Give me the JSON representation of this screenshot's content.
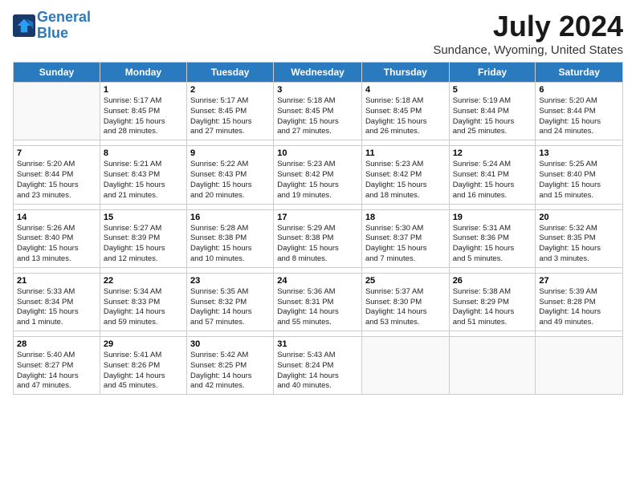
{
  "header": {
    "logo_line1": "General",
    "logo_line2": "Blue",
    "title": "July 2024",
    "subtitle": "Sundance, Wyoming, United States"
  },
  "days_of_week": [
    "Sunday",
    "Monday",
    "Tuesday",
    "Wednesday",
    "Thursday",
    "Friday",
    "Saturday"
  ],
  "weeks": [
    [
      {
        "num": "",
        "info": ""
      },
      {
        "num": "1",
        "info": "Sunrise: 5:17 AM\nSunset: 8:45 PM\nDaylight: 15 hours\nand 28 minutes."
      },
      {
        "num": "2",
        "info": "Sunrise: 5:17 AM\nSunset: 8:45 PM\nDaylight: 15 hours\nand 27 minutes."
      },
      {
        "num": "3",
        "info": "Sunrise: 5:18 AM\nSunset: 8:45 PM\nDaylight: 15 hours\nand 27 minutes."
      },
      {
        "num": "4",
        "info": "Sunrise: 5:18 AM\nSunset: 8:45 PM\nDaylight: 15 hours\nand 26 minutes."
      },
      {
        "num": "5",
        "info": "Sunrise: 5:19 AM\nSunset: 8:44 PM\nDaylight: 15 hours\nand 25 minutes."
      },
      {
        "num": "6",
        "info": "Sunrise: 5:20 AM\nSunset: 8:44 PM\nDaylight: 15 hours\nand 24 minutes."
      }
    ],
    [
      {
        "num": "7",
        "info": "Sunrise: 5:20 AM\nSunset: 8:44 PM\nDaylight: 15 hours\nand 23 minutes."
      },
      {
        "num": "8",
        "info": "Sunrise: 5:21 AM\nSunset: 8:43 PM\nDaylight: 15 hours\nand 21 minutes."
      },
      {
        "num": "9",
        "info": "Sunrise: 5:22 AM\nSunset: 8:43 PM\nDaylight: 15 hours\nand 20 minutes."
      },
      {
        "num": "10",
        "info": "Sunrise: 5:23 AM\nSunset: 8:42 PM\nDaylight: 15 hours\nand 19 minutes."
      },
      {
        "num": "11",
        "info": "Sunrise: 5:23 AM\nSunset: 8:42 PM\nDaylight: 15 hours\nand 18 minutes."
      },
      {
        "num": "12",
        "info": "Sunrise: 5:24 AM\nSunset: 8:41 PM\nDaylight: 15 hours\nand 16 minutes."
      },
      {
        "num": "13",
        "info": "Sunrise: 5:25 AM\nSunset: 8:40 PM\nDaylight: 15 hours\nand 15 minutes."
      }
    ],
    [
      {
        "num": "14",
        "info": "Sunrise: 5:26 AM\nSunset: 8:40 PM\nDaylight: 15 hours\nand 13 minutes."
      },
      {
        "num": "15",
        "info": "Sunrise: 5:27 AM\nSunset: 8:39 PM\nDaylight: 15 hours\nand 12 minutes."
      },
      {
        "num": "16",
        "info": "Sunrise: 5:28 AM\nSunset: 8:38 PM\nDaylight: 15 hours\nand 10 minutes."
      },
      {
        "num": "17",
        "info": "Sunrise: 5:29 AM\nSunset: 8:38 PM\nDaylight: 15 hours\nand 8 minutes."
      },
      {
        "num": "18",
        "info": "Sunrise: 5:30 AM\nSunset: 8:37 PM\nDaylight: 15 hours\nand 7 minutes."
      },
      {
        "num": "19",
        "info": "Sunrise: 5:31 AM\nSunset: 8:36 PM\nDaylight: 15 hours\nand 5 minutes."
      },
      {
        "num": "20",
        "info": "Sunrise: 5:32 AM\nSunset: 8:35 PM\nDaylight: 15 hours\nand 3 minutes."
      }
    ],
    [
      {
        "num": "21",
        "info": "Sunrise: 5:33 AM\nSunset: 8:34 PM\nDaylight: 15 hours\nand 1 minute."
      },
      {
        "num": "22",
        "info": "Sunrise: 5:34 AM\nSunset: 8:33 PM\nDaylight: 14 hours\nand 59 minutes."
      },
      {
        "num": "23",
        "info": "Sunrise: 5:35 AM\nSunset: 8:32 PM\nDaylight: 14 hours\nand 57 minutes."
      },
      {
        "num": "24",
        "info": "Sunrise: 5:36 AM\nSunset: 8:31 PM\nDaylight: 14 hours\nand 55 minutes."
      },
      {
        "num": "25",
        "info": "Sunrise: 5:37 AM\nSunset: 8:30 PM\nDaylight: 14 hours\nand 53 minutes."
      },
      {
        "num": "26",
        "info": "Sunrise: 5:38 AM\nSunset: 8:29 PM\nDaylight: 14 hours\nand 51 minutes."
      },
      {
        "num": "27",
        "info": "Sunrise: 5:39 AM\nSunset: 8:28 PM\nDaylight: 14 hours\nand 49 minutes."
      }
    ],
    [
      {
        "num": "28",
        "info": "Sunrise: 5:40 AM\nSunset: 8:27 PM\nDaylight: 14 hours\nand 47 minutes."
      },
      {
        "num": "29",
        "info": "Sunrise: 5:41 AM\nSunset: 8:26 PM\nDaylight: 14 hours\nand 45 minutes."
      },
      {
        "num": "30",
        "info": "Sunrise: 5:42 AM\nSunset: 8:25 PM\nDaylight: 14 hours\nand 42 minutes."
      },
      {
        "num": "31",
        "info": "Sunrise: 5:43 AM\nSunset: 8:24 PM\nDaylight: 14 hours\nand 40 minutes."
      },
      {
        "num": "",
        "info": ""
      },
      {
        "num": "",
        "info": ""
      },
      {
        "num": "",
        "info": ""
      }
    ]
  ]
}
